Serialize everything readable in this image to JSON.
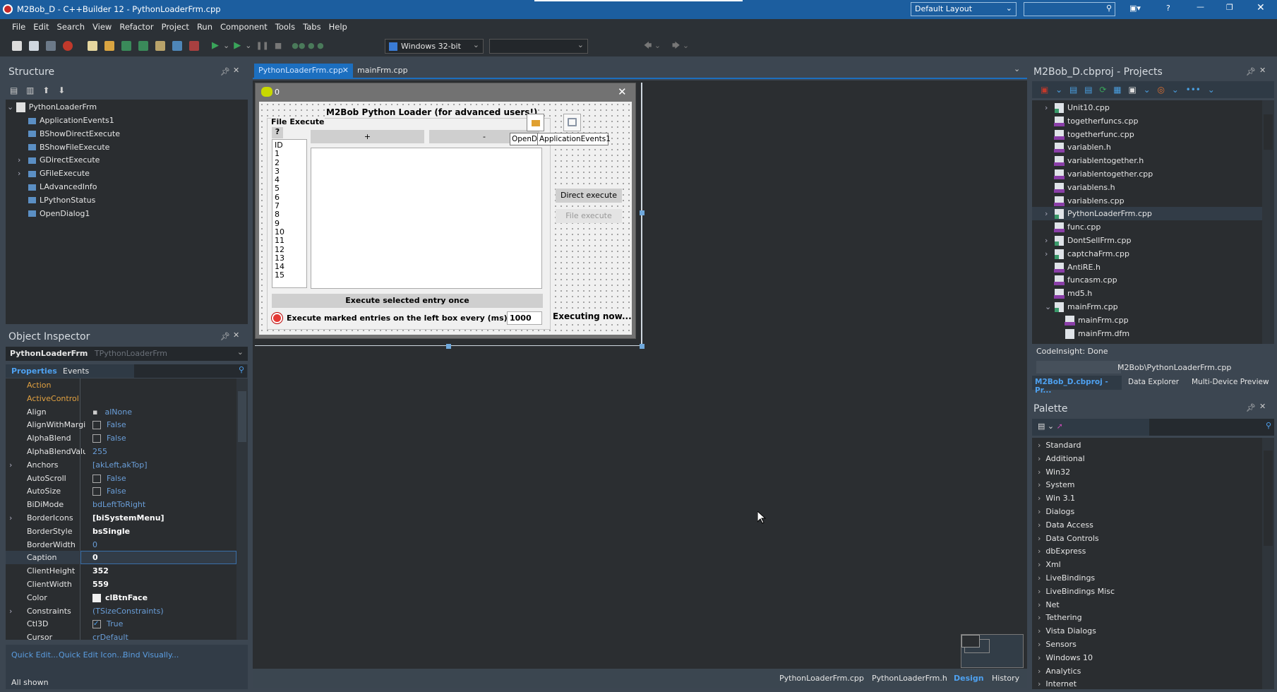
{
  "window": {
    "title": "M2Bob_D - C++Builder 12 - PythonLoaderFrm.cpp",
    "layout_select": "Default Layout",
    "search_placeholder": "",
    "accent": "#1c5e9f"
  },
  "menu": [
    "File",
    "Edit",
    "Search",
    "View",
    "Refactor",
    "Project",
    "Run",
    "Component",
    "Tools",
    "Tabs",
    "Help"
  ],
  "toolbar": {
    "platform": "Windows 32-bit",
    "config": ""
  },
  "structure": {
    "title": "Structure",
    "root": "PythonLoaderFrm",
    "items": [
      {
        "label": "ApplicationEvents1",
        "expandable": false
      },
      {
        "label": "BShowDirectExecute",
        "expandable": false
      },
      {
        "label": "BShowFileExecute",
        "expandable": false
      },
      {
        "label": "GDirectExecute",
        "expandable": true
      },
      {
        "label": "GFileExecute",
        "expandable": true
      },
      {
        "label": "LAdvancedInfo",
        "expandable": false
      },
      {
        "label": "LPythonStatus",
        "expandable": false
      },
      {
        "label": "OpenDialog1",
        "expandable": false
      }
    ]
  },
  "editor": {
    "tabs": [
      {
        "label": "PythonLoaderFrm.cpp",
        "active": true
      },
      {
        "label": "mainFrm.cpp",
        "active": false
      }
    ],
    "bottom_tabs": [
      {
        "label": "PythonLoaderFrm.cpp",
        "active": false
      },
      {
        "label": "PythonLoaderFrm.h",
        "active": false
      },
      {
        "label": "Design",
        "active": true
      },
      {
        "label": "History",
        "active": false
      }
    ]
  },
  "form": {
    "caption": "0",
    "heading": "M2Bob Python Loader (for advanced users!)",
    "group": "File Execute",
    "help_btn": "?",
    "id_list": [
      "ID",
      "1",
      "2",
      "3",
      "4",
      "5",
      "6",
      "7",
      "8",
      "9",
      "10",
      "11",
      "12",
      "13",
      "14",
      "15"
    ],
    "add_btn": "+",
    "remove_btn": "-",
    "direct_execute": "Direct execute",
    "file_execute": "File execute",
    "execute_once": "Execute selected entry once",
    "interval_label": "Execute marked entries on the left box every (ms):",
    "interval_value": "1000",
    "status": "Executing now...",
    "tooltip_open": "OpenD",
    "tooltip_events": "ApplicationEvents1"
  },
  "inspector": {
    "title": "Object Inspector",
    "object": "PythonLoaderFrm",
    "type": "TPythonLoaderFrm",
    "tabs": [
      "Properties",
      "Events"
    ],
    "rows": [
      {
        "name": "Action",
        "value": "",
        "kind": "event"
      },
      {
        "name": "ActiveControl",
        "value": "",
        "kind": "event"
      },
      {
        "name": "Align",
        "value": "alNone",
        "kind": "align"
      },
      {
        "name": "AlignWithMargins",
        "value": "False",
        "kind": "check"
      },
      {
        "name": "AlphaBlend",
        "value": "False",
        "kind": "check"
      },
      {
        "name": "AlphaBlendValue",
        "value": "255",
        "kind": "default"
      },
      {
        "name": "Anchors",
        "value": "[akLeft,akTop]",
        "kind": "default",
        "expand": true
      },
      {
        "name": "AutoScroll",
        "value": "False",
        "kind": "check"
      },
      {
        "name": "AutoSize",
        "value": "False",
        "kind": "check"
      },
      {
        "name": "BiDiMode",
        "value": "bdLeftToRight",
        "kind": "default"
      },
      {
        "name": "BorderIcons",
        "value": "[biSystemMenu]",
        "kind": "bold",
        "expand": true
      },
      {
        "name": "BorderStyle",
        "value": "bsSingle",
        "kind": "bold"
      },
      {
        "name": "BorderWidth",
        "value": "0",
        "kind": "default"
      },
      {
        "name": "Caption",
        "value": "0",
        "kind": "selected"
      },
      {
        "name": "ClientHeight",
        "value": "352",
        "kind": "bold"
      },
      {
        "name": "ClientWidth",
        "value": "559",
        "kind": "bold"
      },
      {
        "name": "Color",
        "value": "clBtnFace",
        "kind": "color"
      },
      {
        "name": "Constraints",
        "value": "(TSizeConstraints)",
        "kind": "default",
        "expand": true
      },
      {
        "name": "Ctl3D",
        "value": "True",
        "kind": "checked"
      },
      {
        "name": "Cursor",
        "value": "crDefault",
        "kind": "default"
      }
    ],
    "links": [
      "Quick Edit...",
      "Quick Edit Icon...",
      "Bind Visually..."
    ],
    "status": "All shown"
  },
  "projects": {
    "title": "M2Bob_D.cbproj - Projects",
    "items": [
      {
        "label": "Unit10.cpp",
        "icon": "unit",
        "expand": "closed",
        "indent": 0
      },
      {
        "label": "togetherfuncs.cpp",
        "icon": "cpp",
        "indent": 0
      },
      {
        "label": "togetherfunc.cpp",
        "icon": "cpp",
        "indent": 0
      },
      {
        "label": "variablen.h",
        "icon": "h",
        "indent": 0
      },
      {
        "label": "variablentogether.h",
        "icon": "h",
        "indent": 0
      },
      {
        "label": "variablentogether.cpp",
        "icon": "cpp",
        "indent": 0
      },
      {
        "label": "variablens.h",
        "icon": "h",
        "indent": 0
      },
      {
        "label": "variablens.cpp",
        "icon": "cpp",
        "indent": 0
      },
      {
        "label": "PythonLoaderFrm.cpp",
        "icon": "unit",
        "expand": "closed",
        "indent": 0,
        "selected": true
      },
      {
        "label": "func.cpp",
        "icon": "cpp",
        "indent": 0
      },
      {
        "label": "DontSellFrm.cpp",
        "icon": "unit",
        "expand": "closed",
        "indent": 0
      },
      {
        "label": "captchaFrm.cpp",
        "icon": "unit",
        "expand": "closed",
        "indent": 0
      },
      {
        "label": "AntiRE.h",
        "icon": "h",
        "indent": 0
      },
      {
        "label": "funcasm.cpp",
        "icon": "cpp",
        "indent": 0
      },
      {
        "label": "md5.h",
        "icon": "h",
        "indent": 0
      },
      {
        "label": "mainFrm.cpp",
        "icon": "unit",
        "expand": "open",
        "indent": 0
      },
      {
        "label": "mainFrm.cpp",
        "icon": "cpp",
        "indent": 1
      },
      {
        "label": "mainFrm.dfm",
        "icon": "dfm",
        "indent": 1
      }
    ],
    "codeinsight": "CodeInsight: Done",
    "path": "M2Bob\\PythonLoaderFrm.cpp",
    "tabs": [
      "M2Bob_D.cbproj - Pr...",
      "Data Explorer",
      "Multi-Device Preview"
    ]
  },
  "palette": {
    "title": "Palette",
    "items": [
      "Standard",
      "Additional",
      "Win32",
      "System",
      "Win 3.1",
      "Dialogs",
      "Data Access",
      "Data Controls",
      "dbExpress",
      "Xml",
      "LiveBindings",
      "LiveBindings Misc",
      "Net",
      "Tethering",
      "Vista Dialogs",
      "Sensors",
      "Windows 10",
      "Analytics",
      "Internet"
    ]
  }
}
